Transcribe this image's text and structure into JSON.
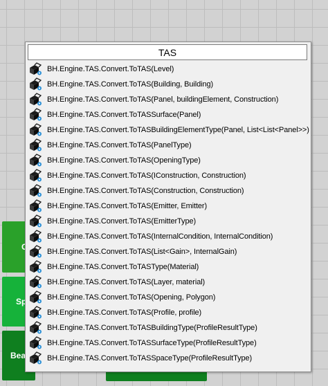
{
  "canvas": {
    "tiles": [
      {
        "label": "C"
      },
      {
        "label": "Sp"
      },
      {
        "label": "Bea"
      },
      {
        "label": ""
      }
    ]
  },
  "search": {
    "value": "TAS"
  },
  "results": [
    "BH.Engine.TAS.Convert.ToTAS(Level)",
    "BH.Engine.TAS.Convert.ToTAS(Building, Building)",
    "BH.Engine.TAS.Convert.ToTAS(Panel, buildingElement, Construction)",
    "BH.Engine.TAS.Convert.ToTASSurface(Panel)",
    "BH.Engine.TAS.Convert.ToTASBuildingElementType(Panel, List<List<Panel>>)",
    "BH.Engine.TAS.Convert.ToTAS(PanelType)",
    "BH.Engine.TAS.Convert.ToTAS(OpeningType)",
    "BH.Engine.TAS.Convert.ToTAS(IConstruction, Construction)",
    "BH.Engine.TAS.Convert.ToTAS(Construction, Construction)",
    "BH.Engine.TAS.Convert.ToTAS(Emitter, Emitter)",
    "BH.Engine.TAS.Convert.ToTAS(EmitterType)",
    "BH.Engine.TAS.Convert.ToTAS(InternalCondition, InternalCondition)",
    "BH.Engine.TAS.Convert.ToTAS(List<Gain>, InternalGain)",
    "BH.Engine.TAS.Convert.ToTASType(Material)",
    "BH.Engine.TAS.Convert.ToTAS(Layer, material)",
    "BH.Engine.TAS.Convert.ToTAS(Opening, Polygon)",
    "BH.Engine.TAS.Convert.ToTAS(Profile, profile)",
    "BH.Engine.TAS.Convert.ToTASBuildingType(ProfileResultType)",
    "BH.Engine.TAS.Convert.ToTASSurfaceType(ProfileResultType)",
    "BH.Engine.TAS.Convert.ToTASSpaceType(ProfileResultType)"
  ],
  "icon": {
    "name": "bhom-engine-component-icon",
    "primary": "#1b1b1b",
    "accent": "#2a8fd6"
  }
}
